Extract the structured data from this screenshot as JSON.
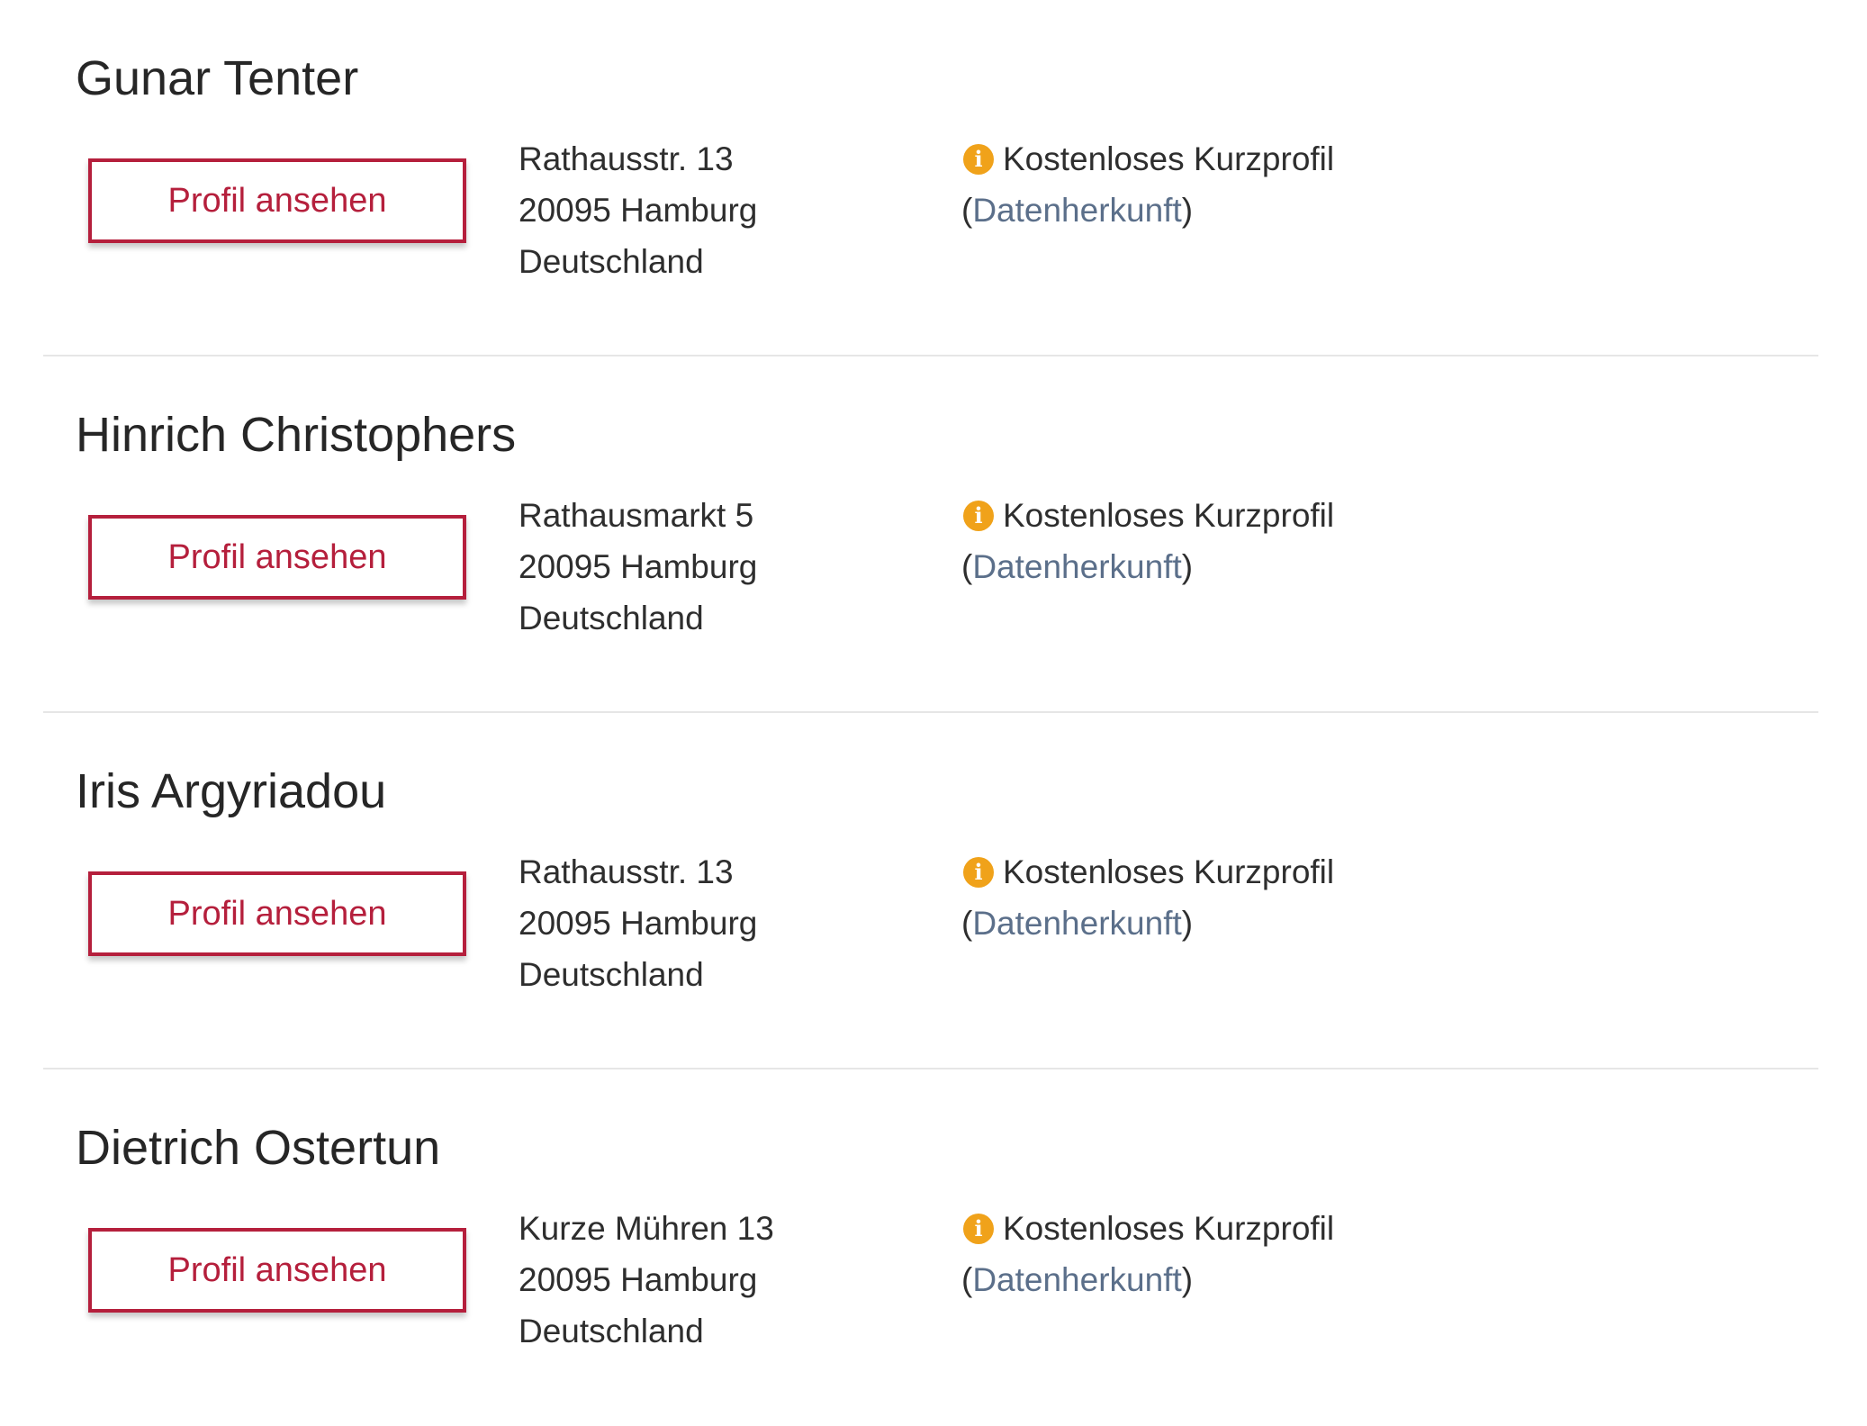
{
  "results": [
    {
      "name": "Gunar Tenter",
      "button_label": "Profil ansehen",
      "address": [
        "Rathausstr. 13",
        "20095 Hamburg",
        "Deutschland"
      ],
      "info_label": "Kostenloses Kurzprofil",
      "source_link": "Datenherkunft"
    },
    {
      "name": "Hinrich Christophers",
      "button_label": "Profil ansehen",
      "address": [
        "Rathausmarkt 5",
        "20095 Hamburg",
        "Deutschland"
      ],
      "info_label": "Kostenloses Kurzprofil",
      "source_link": "Datenherkunft"
    },
    {
      "name": "Iris Argyriadou",
      "button_label": "Profil ansehen",
      "address": [
        "Rathausstr. 13",
        "20095 Hamburg",
        "Deutschland"
      ],
      "info_label": "Kostenloses Kurzprofil",
      "source_link": "Datenherkunft"
    },
    {
      "name": "Dietrich Ostertun",
      "button_label": "Profil ansehen",
      "address": [
        "Kurze Mühren 13",
        "20095 Hamburg",
        "Deutschland"
      ],
      "info_label": "Kostenloses Kurzprofil",
      "source_link": "Datenherkunft"
    }
  ],
  "icons": {
    "info": "info-circle-icon"
  },
  "colors": {
    "accent_red": "#b51f3c",
    "info_orange": "#f0a21a",
    "link_gray_blue": "#5b6f8a",
    "divider": "#e6e6e6"
  }
}
